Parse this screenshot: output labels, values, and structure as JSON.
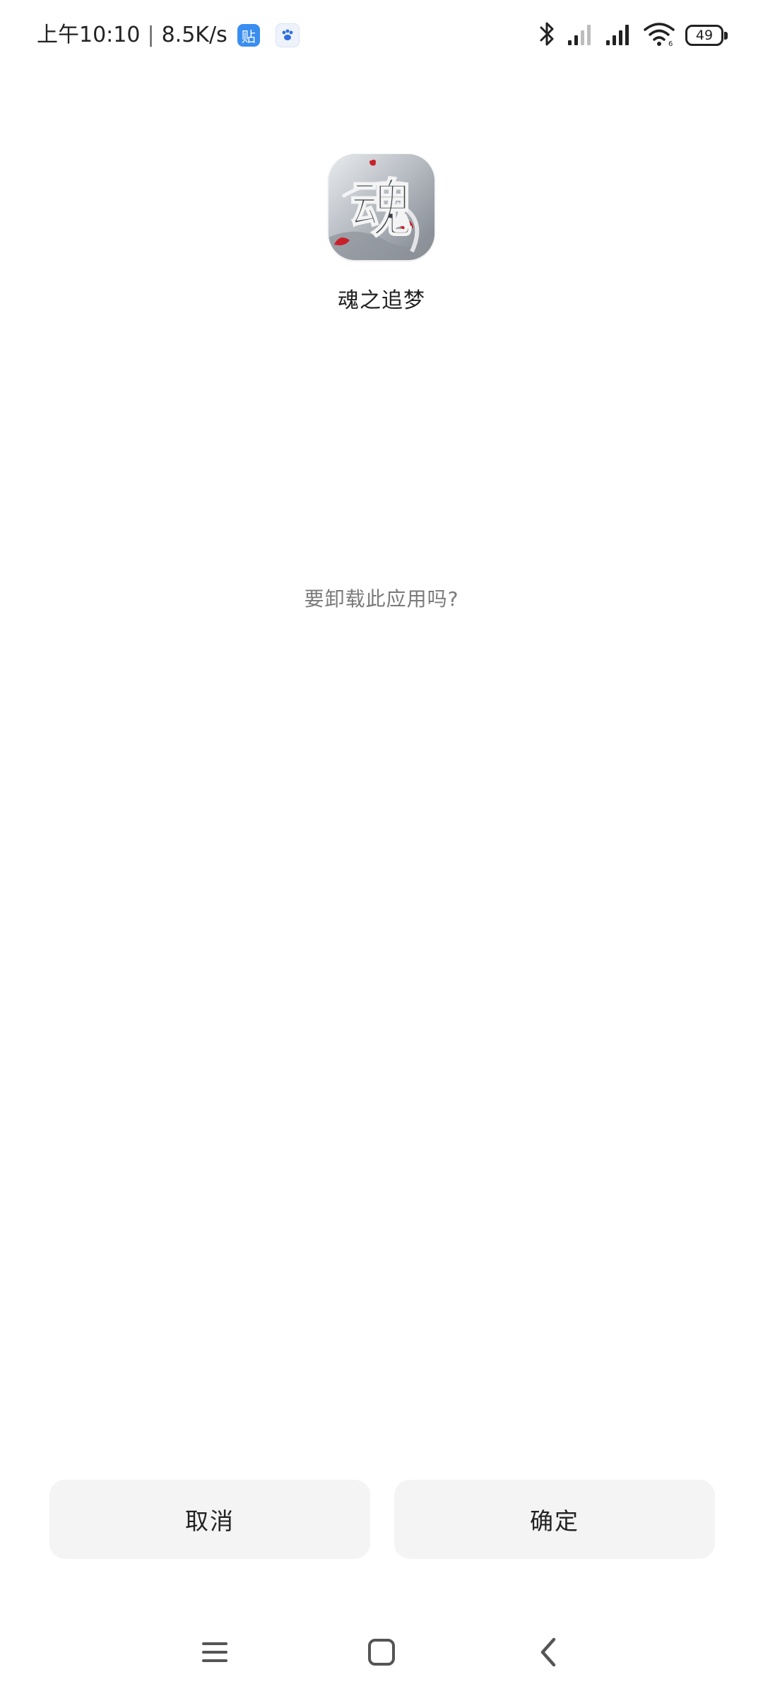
{
  "status_bar": {
    "time": "上午10:10",
    "separator": "|",
    "net_speed": "8.5K/s",
    "notif_badge_text": "贴",
    "notif_app_icon": "baidu-paw-icon",
    "icons": [
      "bluetooth-icon",
      "cell-signal-icon",
      "cell-signal-icon",
      "wifi-icon",
      "battery-icon"
    ],
    "battery_level": "49"
  },
  "app": {
    "name": "魂之追梦",
    "icon": "app-icon-soul-calligraphy",
    "icon_glyph": "魂"
  },
  "dialog": {
    "message": "要卸载此应用吗?"
  },
  "buttons": {
    "cancel": "取消",
    "confirm": "确定"
  },
  "nav_bar": {
    "icons": [
      "menu-icon",
      "home-icon",
      "back-icon"
    ]
  },
  "colors": {
    "background": "#ffffff",
    "button_bg": "#f4f4f4",
    "message_text": "#7a7a7a",
    "badge_blue": "#3a8ef0"
  }
}
